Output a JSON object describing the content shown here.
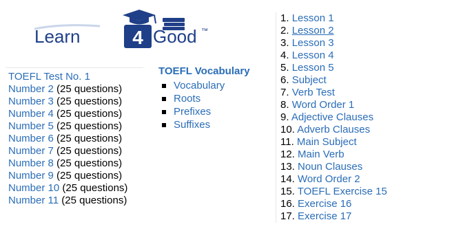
{
  "logo": {
    "text_left": "Learn",
    "text_number": "4",
    "text_right": "Good",
    "trademark": "™",
    "colors": {
      "text": "#1f3f88",
      "number_bg": "#1f3f88",
      "number_text": "#ffffff",
      "cap": "#1f3f88"
    }
  },
  "tests": [
    {
      "link": "TOEFL Test No. 1",
      "suffix": ""
    },
    {
      "link": "Number 2",
      "suffix": " (25 questions)"
    },
    {
      "link": "Number 3",
      "suffix": " (25 questions)"
    },
    {
      "link": "Number 4",
      "suffix": " (25 questions)"
    },
    {
      "link": "Number 5",
      "suffix": " (25 questions)"
    },
    {
      "link": "Number 6",
      "suffix": " (25 questions)"
    },
    {
      "link": "Number 7",
      "suffix": " (25 questions)"
    },
    {
      "link": "Number 8",
      "suffix": " (25 questions)"
    },
    {
      "link": "Number 9",
      "suffix": " (25 questions)"
    },
    {
      "link": "Number 10",
      "suffix": " (25 questions)"
    },
    {
      "link": "Number 11",
      "suffix": " (25 questions)"
    }
  ],
  "vocabulary": {
    "heading": "TOEFL Vocabulary",
    "items": [
      "Vocabulary",
      "Roots",
      "Prefixes",
      "Suffixes"
    ]
  },
  "lessons": [
    {
      "num": "1.",
      "label": "Lesson 1"
    },
    {
      "num": "2.",
      "label": "Lesson 2",
      "hovered": true
    },
    {
      "num": "3.",
      "label": "Lesson 3"
    },
    {
      "num": "4.",
      "label": "Lesson 4"
    },
    {
      "num": "5.",
      "label": "Lesson 5"
    },
    {
      "num": "6.",
      "label": "Subject"
    },
    {
      "num": "7.",
      "label": "Verb Test"
    },
    {
      "num": "8.",
      "label": "Word Order 1"
    },
    {
      "num": "9.",
      "label": "Adjective Clauses"
    },
    {
      "num": "10.",
      "label": "Adverb Clauses"
    },
    {
      "num": "11.",
      "label": "Main Subject"
    },
    {
      "num": "12.",
      "label": "Main Verb"
    },
    {
      "num": "13.",
      "label": "Noun Clauses"
    },
    {
      "num": "14.",
      "label": "Word Order 2"
    },
    {
      "num": "15.",
      "label": "TOEFL Exercise 15"
    },
    {
      "num": "16.",
      "label": "Exercise 16"
    },
    {
      "num": "17.",
      "label": "Exercise 17"
    }
  ],
  "colors": {
    "link": "#2a6db7",
    "text": "#000000"
  }
}
